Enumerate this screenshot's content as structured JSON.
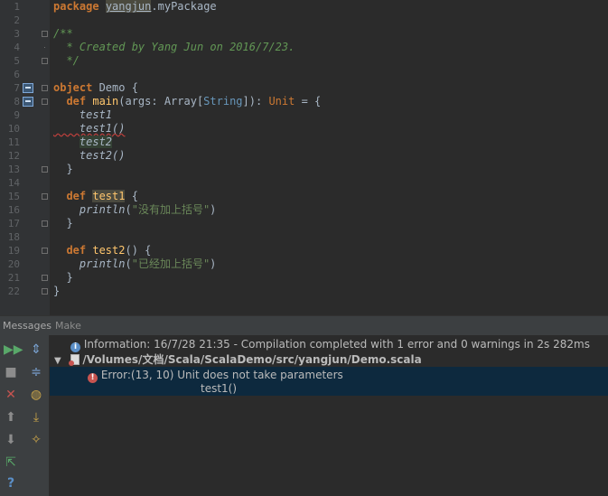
{
  "editor": {
    "line_numbers": [
      "1",
      "2",
      "3",
      "4",
      "5",
      "6",
      "7",
      "8",
      "9",
      "10",
      "11",
      "12",
      "13",
      "14",
      "15",
      "16",
      "17",
      "18",
      "19",
      "20",
      "21",
      "22"
    ],
    "code": {
      "l1_kw": "package",
      "l1_name": "yangjun",
      "l1_rest": ".myPackage",
      "l3": "/**",
      "l4": "  * Created by Yang Jun on 2016/7/23.",
      "l5": "  */",
      "l7_kw": "object",
      "l7_rest": " Demo {",
      "l8_kw": "  def",
      "l8_fn": " main",
      "l8_a": "(args: Array[",
      "l8_ty": "String",
      "l8_b": "]): ",
      "l8_unit": "Unit",
      "l8_c": " = {",
      "l9": "    test1",
      "l10": "    test1()",
      "l11": "test2",
      "l12": "    test2()",
      "l13": "  }",
      "l15_kw": "  def",
      "l15_fn": "test1",
      "l15_rest": " {",
      "l16_fn": "    println",
      "l16_a": "(",
      "l16_str": "\"没有加上括号\"",
      "l16_b": ")",
      "l17": "  }",
      "l19_kw": "  def",
      "l19_fn": " test2",
      "l19_rest": "() {",
      "l20_fn": "    println",
      "l20_a": "(",
      "l20_str": "\"已经加上括号\"",
      "l20_b": ")",
      "l21": "  }",
      "l22": "}"
    }
  },
  "messages_panel": {
    "title": "Messages",
    "tab": "Make",
    "info": "Information: 16/7/28 21:35 - Compilation completed with 1 error and 0 warnings in 2s 282ms",
    "file_path": "/Volumes/文档/Scala/ScalaDemo/src/yangjun/Demo.scala",
    "error_text": "Error:(13, 10)  Unit does not take parameters",
    "error_code": "test1()"
  },
  "icons": {
    "rerun": "rerun-icon",
    "stop": "stop-icon",
    "close": "close-icon",
    "up": "up-arrow-icon",
    "down": "down-arrow-icon",
    "export": "export-icon",
    "help": "help-icon",
    "expand": "expand-all-icon",
    "collapse": "collapse-all-icon",
    "filter_warnings": "hide-warnings-icon",
    "autoscroll": "autoscroll-icon",
    "settings": "settings-icon"
  },
  "colors": {
    "keyword": "#cc7832",
    "function": "#ffc66d",
    "comment": "#629755",
    "string": "#6a8759",
    "error": "#c75450",
    "info": "#5b8fc7"
  }
}
